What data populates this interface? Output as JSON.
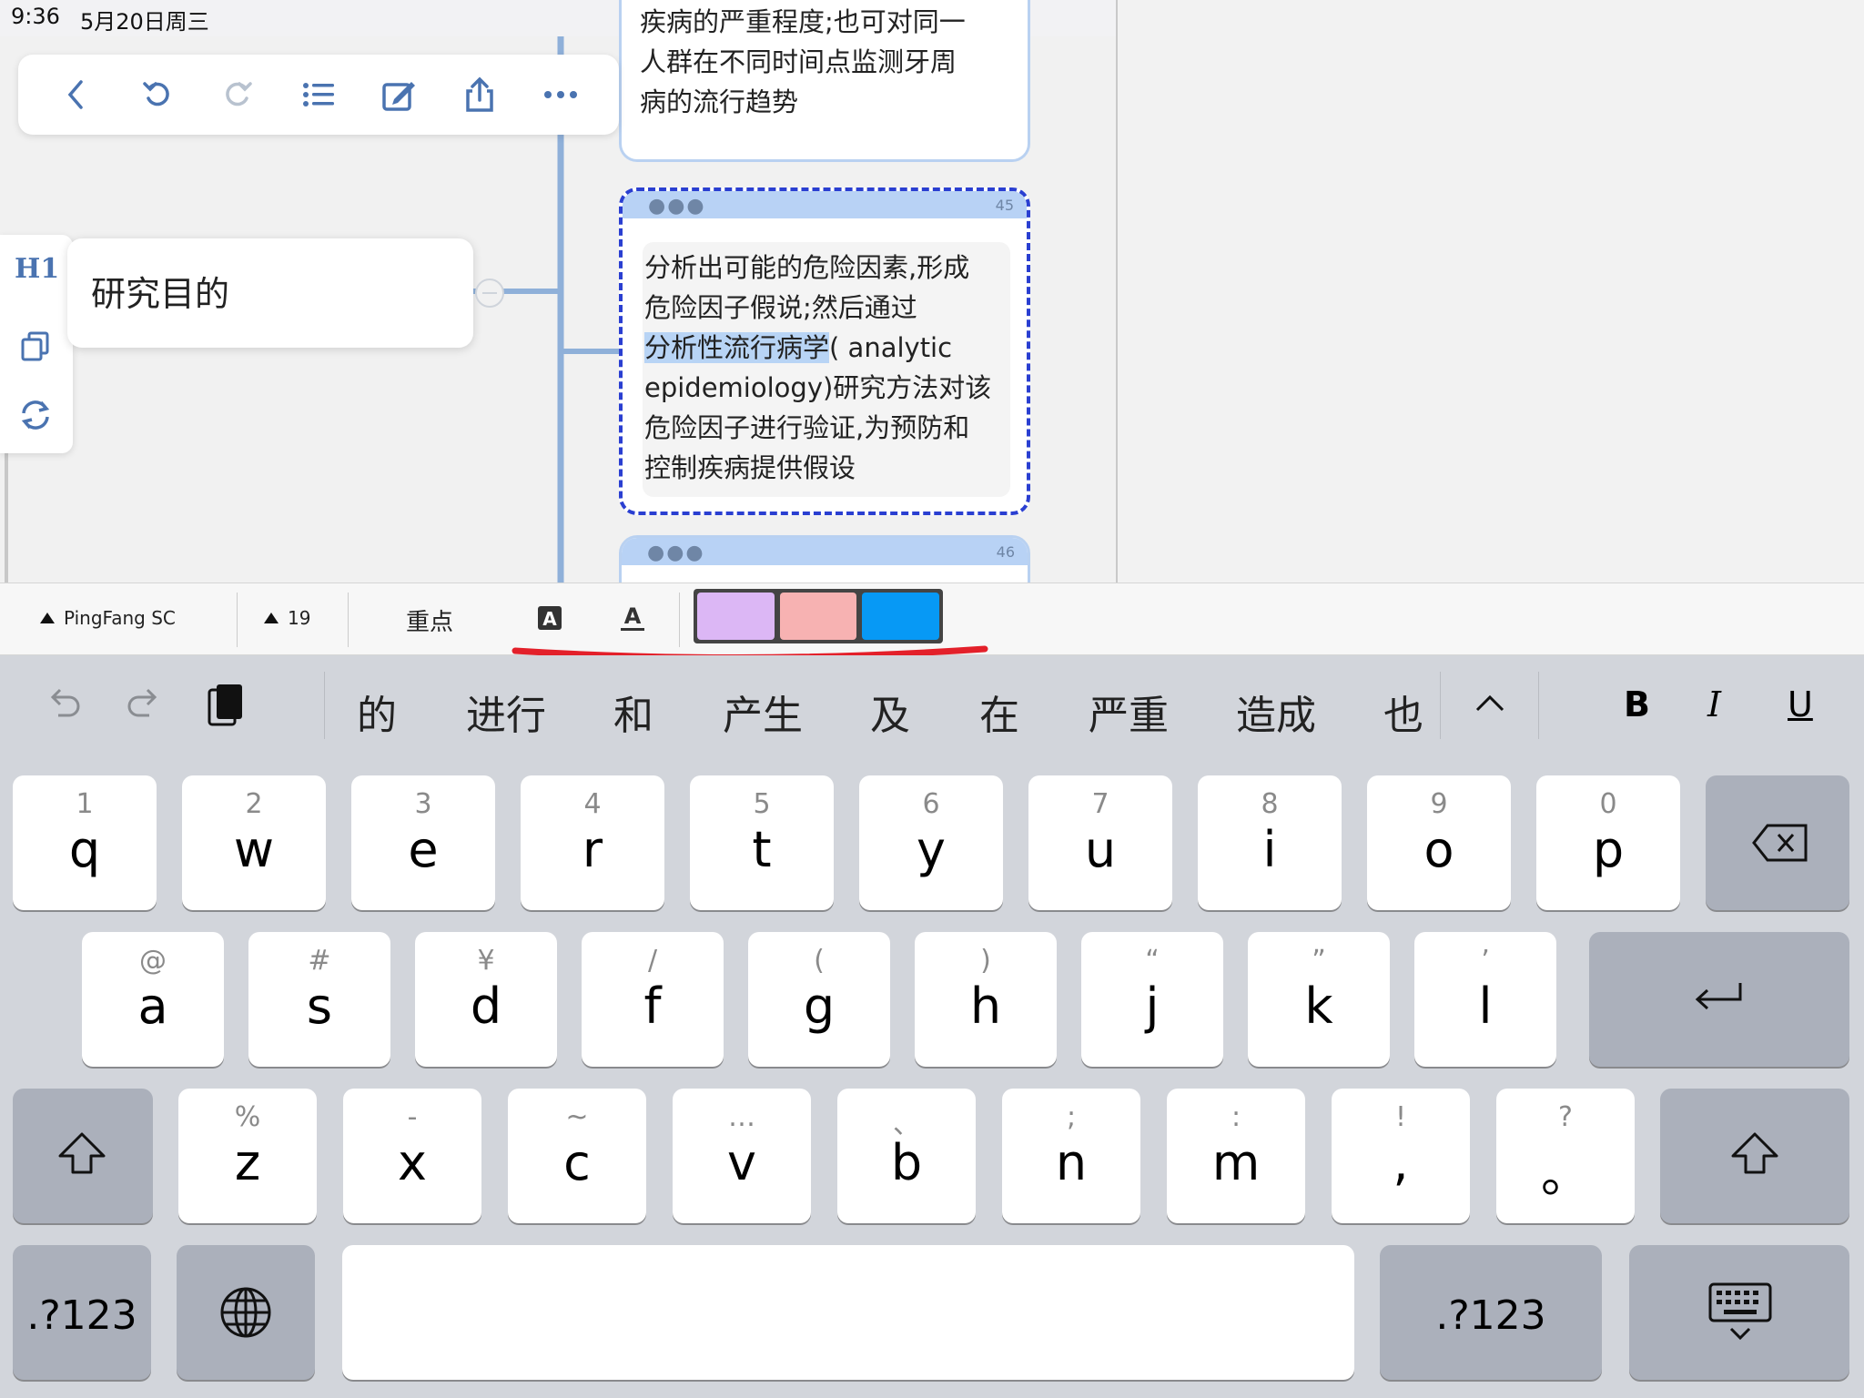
{
  "status_bar": {
    "time": "9:36",
    "date": "5月20日周三"
  },
  "toolbar": {
    "buttons": [
      "back-icon",
      "undo-icon",
      "redo-icon",
      "outline-icon",
      "edit-icon",
      "share-icon",
      "more-icon"
    ]
  },
  "side_panel": {
    "heading_label": "H1"
  },
  "mindmap": {
    "node_label": "研究目的",
    "card_top": {
      "lines": [
        "疾病的严重程度;也可对同一",
        "人群在不同时间点监测牙周",
        "病的流行趋势"
      ]
    },
    "card_45": {
      "dots": "●●●",
      "number": "45",
      "lines": [
        "分析出可能的危险因素,形成",
        "危险因子假说;然后通过"
      ],
      "highlighted": "分析性流行病学",
      "line3_rest": "( analytic",
      "lines_after": [
        "epidemiology)研究方法对该",
        "危险因子进行验证,为预防和",
        "控制疾病提供假设"
      ]
    },
    "card_46": {
      "dots": "●●●",
      "number": "46"
    }
  },
  "format_bar": {
    "font_name": "PingFang SC",
    "font_size": "19",
    "emphasis_label": "重点",
    "swatches": [
      "#dcb7f5",
      "#f7b2b2",
      "#0799f5"
    ]
  },
  "keyboard": {
    "candidates": [
      "的",
      "进行",
      "和",
      "产生",
      "及",
      "在",
      "严重",
      "造成",
      "也"
    ],
    "format_bold": "B",
    "format_italic": "I",
    "format_underline": "U",
    "row1": [
      {
        "sub": "1",
        "main": "q"
      },
      {
        "sub": "2",
        "main": "w"
      },
      {
        "sub": "3",
        "main": "e"
      },
      {
        "sub": "4",
        "main": "r"
      },
      {
        "sub": "5",
        "main": "t"
      },
      {
        "sub": "6",
        "main": "y"
      },
      {
        "sub": "7",
        "main": "u"
      },
      {
        "sub": "8",
        "main": "i"
      },
      {
        "sub": "9",
        "main": "o"
      },
      {
        "sub": "0",
        "main": "p"
      }
    ],
    "row2": [
      {
        "sub": "@",
        "main": "a"
      },
      {
        "sub": "#",
        "main": "s"
      },
      {
        "sub": "¥",
        "main": "d"
      },
      {
        "sub": "/",
        "main": "f"
      },
      {
        "sub": "(",
        "main": "g"
      },
      {
        "sub": ")",
        "main": "h"
      },
      {
        "sub": "“",
        "main": "j"
      },
      {
        "sub": "”",
        "main": "k"
      },
      {
        "sub": "’",
        "main": "l"
      }
    ],
    "row3": [
      {
        "sub": "%",
        "main": "z"
      },
      {
        "sub": "-",
        "main": "x"
      },
      {
        "sub": "~",
        "main": "c"
      },
      {
        "sub": "…",
        "main": "v"
      },
      {
        "sub": "、",
        "main": "b"
      },
      {
        "sub": ";",
        "main": "n"
      },
      {
        "sub": ":",
        "main": "m"
      },
      {
        "sub": "!",
        "main": ","
      },
      {
        "sub": "?",
        "main": "。"
      }
    ],
    "numbers_label": ".?123"
  }
}
